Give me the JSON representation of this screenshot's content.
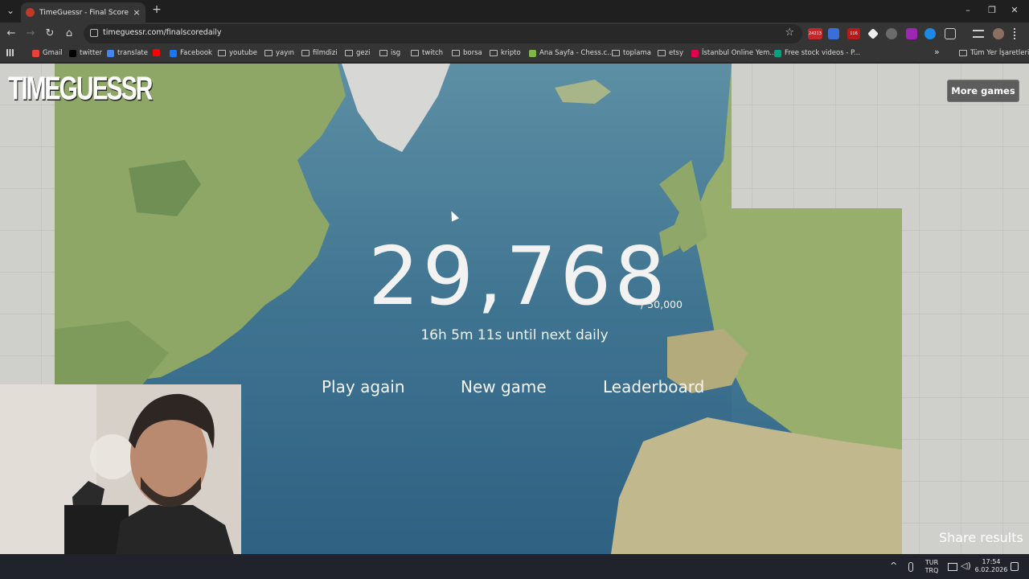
{
  "browser": {
    "tab_title": "TimeGuessr - Final Score",
    "url": "timeguessr.com/finalscoredaily",
    "tab_close": "×",
    "new_tab": "+",
    "win_min": "–",
    "win_max": "❐",
    "win_close": "✕",
    "back": "←",
    "forward": "→",
    "reload": "↻",
    "home": "⌂",
    "star": "☆",
    "ext_badge_1": "24213",
    "ext_badge_2": "116"
  },
  "bookmarks": [
    {
      "label": "Gmail",
      "icon": "gmail-icon",
      "color": "#ea4335"
    },
    {
      "label": "twitter",
      "icon": "x-icon",
      "color": "#000000"
    },
    {
      "label": "translate",
      "icon": "translate-icon",
      "color": "#4285f4"
    },
    {
      "label": "",
      "icon": "youtube-icon",
      "color": "#ff0000"
    },
    {
      "label": "Facebook",
      "icon": "facebook-icon",
      "color": "#1877f2"
    },
    {
      "label": "youtube",
      "icon": "folder-icon"
    },
    {
      "label": "yayın",
      "icon": "folder-icon"
    },
    {
      "label": "filmdizi",
      "icon": "folder-icon"
    },
    {
      "label": "gezi",
      "icon": "folder-icon"
    },
    {
      "label": "isg",
      "icon": "folder-icon"
    },
    {
      "label": "twitch",
      "icon": "folder-icon"
    },
    {
      "label": "borsa",
      "icon": "folder-icon"
    },
    {
      "label": "kripto",
      "icon": "folder-icon"
    },
    {
      "label": "Ana Sayfa - Chess.c...",
      "icon": "chess-icon",
      "color": "#81b64c"
    },
    {
      "label": "toplama",
      "icon": "folder-icon"
    },
    {
      "label": "etsy",
      "icon": "folder-icon"
    },
    {
      "label": "İstanbul Online Yem...",
      "icon": "yemeksepeti-icon",
      "color": "#e5004d"
    },
    {
      "label": "Free stock videos - P...",
      "icon": "pexels-icon",
      "color": "#05a081"
    }
  ],
  "bookmarks_more": "»",
  "bookmarks_all": "Tüm Yer İşaretleri",
  "game": {
    "logo": "TIMEGUESSR",
    "more_games": "More games",
    "score": "29,768",
    "max_score": "/ 50,000",
    "countdown": "16h 5m 11s until next daily",
    "actions": {
      "play_again": "Play again",
      "new_game": "New game",
      "leaderboard": "Leaderboard"
    },
    "share": "Share results"
  },
  "taskbar": {
    "chevron": "^",
    "lang_top": "TUR",
    "lang_bottom": "TRQ",
    "time": "17:54",
    "date": "6.02.2026"
  },
  "colors": {
    "ocean": "#5a8ea3",
    "land": "#8fa86a",
    "ice": "#d8d8d6"
  }
}
